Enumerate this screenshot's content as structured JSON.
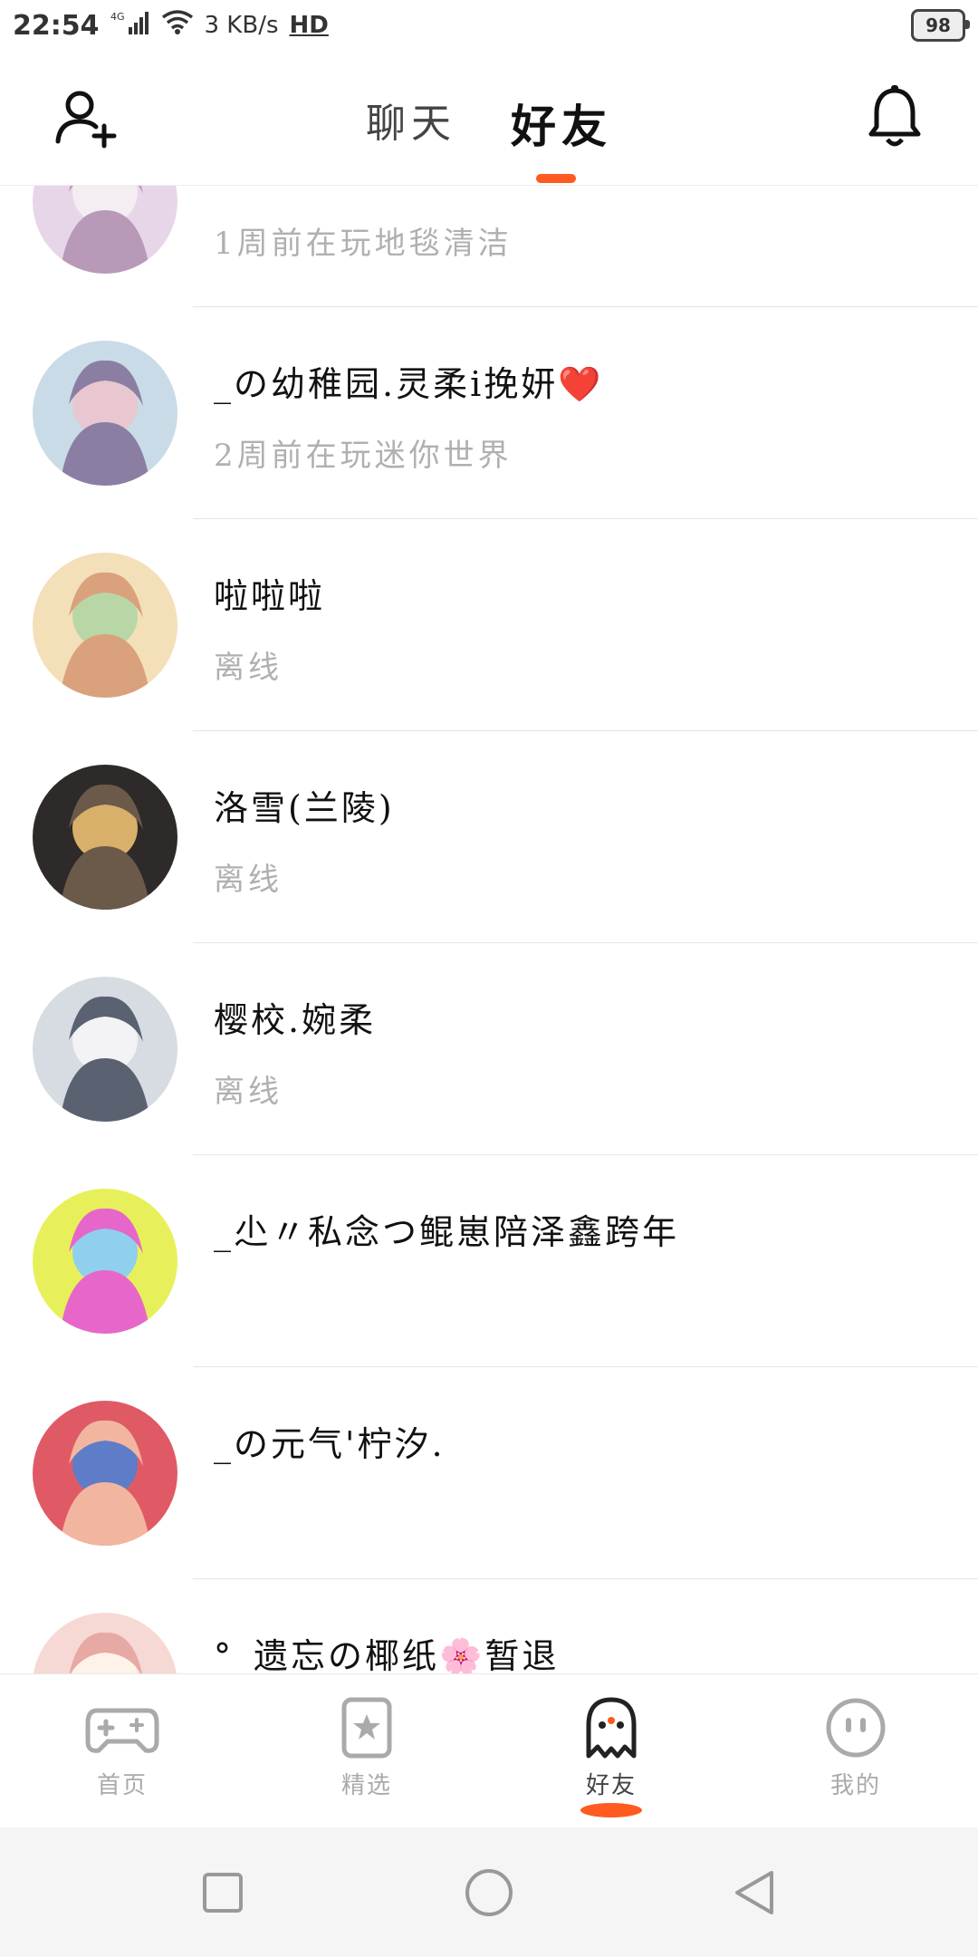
{
  "status_bar": {
    "time": "22:54",
    "network": "4G",
    "speed": "3 KB/s",
    "hd": "HD",
    "battery": "98"
  },
  "header": {
    "tabs": [
      "聊天",
      "好友"
    ],
    "active_tab": "好友",
    "accent_color": "#ff5a1f"
  },
  "friends": [
    {
      "name": "",
      "status": "1周前在玩地毯清洁"
    },
    {
      "name": "_の幼稚园.灵柔i挽妍❤️",
      "status": "2周前在玩迷你世界"
    },
    {
      "name": "啦啦啦",
      "status": "离线"
    },
    {
      "name": "洛雪(兰陵)",
      "status": "离线"
    },
    {
      "name": "樱校.婉柔",
      "status": "离线"
    },
    {
      "name": "_尐〃私念つ鲲崽陪泽鑫跨年",
      "status": ""
    },
    {
      "name": "_の元气'柠汐.",
      "status": ""
    },
    {
      "name": "°_遗忘の椰纸🌸暂退",
      "status": ""
    }
  ],
  "bottom_nav": [
    {
      "label": "首页",
      "icon": "gamepad-icon"
    },
    {
      "label": "精选",
      "icon": "star-card-icon"
    },
    {
      "label": "好友",
      "icon": "ghost-icon",
      "active": true
    },
    {
      "label": "我的",
      "icon": "face-icon"
    }
  ]
}
